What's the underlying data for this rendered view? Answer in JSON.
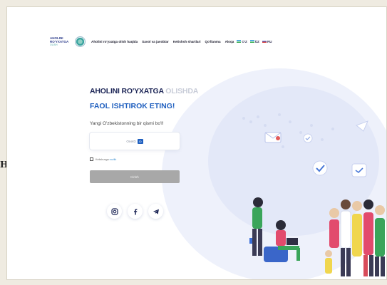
{
  "side_letter": "H",
  "header": {
    "logo_line1": "AHOLINI",
    "logo_line2": "RO'YXATGA",
    "logo_line3": "OLISH",
    "logo_line4": "2023",
    "nav": [
      {
        "label": "Aholini ro'yxatga olish haqida"
      },
      {
        "label": "Savol va javoblar"
      },
      {
        "label": "Ketishsh shartlari"
      },
      {
        "label": "Qo'llanma"
      },
      {
        "label": "Aloqa"
      }
    ],
    "languages": [
      {
        "code": "O'Z",
        "color": "#2c9bd8"
      },
      {
        "code": "ÜZ",
        "color": "#2c9bd8"
      },
      {
        "code": "RU",
        "color": "#d23a3a"
      }
    ]
  },
  "hero": {
    "title_main": "AHOLINI RO'YXATGA ",
    "title_faded": "OLISHDA",
    "subtitle": "FAOL ISHTIROK ETING!",
    "tagline": "Yangi O'zbekistonning bir qismi bo'l!",
    "card_text": "OneID",
    "card_chip": "ID",
    "agree_text": "Kelishuvga",
    "agree_link": "rozilik",
    "button_label": "Kirish"
  },
  "colors": {
    "accent": "#1f5fbf",
    "title": "#1c2556",
    "button": "#a8a8a8"
  }
}
